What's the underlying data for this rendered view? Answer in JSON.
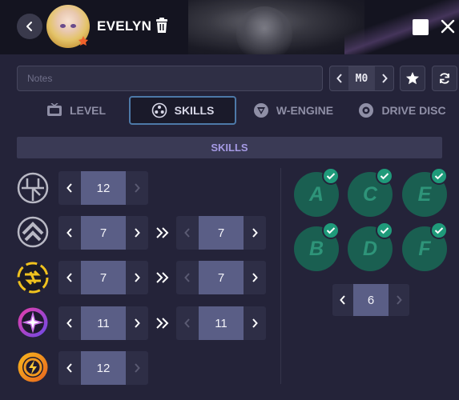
{
  "header": {
    "name": "EVELYN"
  },
  "notes": {
    "placeholder": "Notes",
    "value": ""
  },
  "mindscape": {
    "value": "M0"
  },
  "tabs": [
    {
      "label": "LEVEL",
      "icon": "tv-icon",
      "active": false
    },
    {
      "label": "SKILLS",
      "icon": "skills-icon",
      "active": true
    },
    {
      "label": "W-ENGINE",
      "icon": "w-engine-icon",
      "active": false
    },
    {
      "label": "DRIVE DISC",
      "icon": "drive-disc-icon",
      "active": false
    }
  ],
  "section": {
    "title": "SKILLS"
  },
  "skills": [
    {
      "icon": "basic-attack-icon",
      "current": "12"
    },
    {
      "icon": "dodge-icon",
      "current": "7",
      "target": "7"
    },
    {
      "icon": "assist-icon",
      "current": "7",
      "target": "7"
    },
    {
      "icon": "special-attack-icon",
      "current": "11",
      "target": "11"
    },
    {
      "icon": "chain-attack-icon",
      "current": "12"
    }
  ],
  "core_skills": {
    "nodes": [
      "A",
      "C",
      "E",
      "B",
      "D",
      "F"
    ],
    "all_unlocked": true,
    "level": "6"
  },
  "colors": {
    "background": "#242339",
    "header": "#141420",
    "accent": "#a59ae4",
    "core_node": "#1a5f51",
    "check": "#1f9a7a",
    "tab_active_border": "#4d79a8"
  }
}
